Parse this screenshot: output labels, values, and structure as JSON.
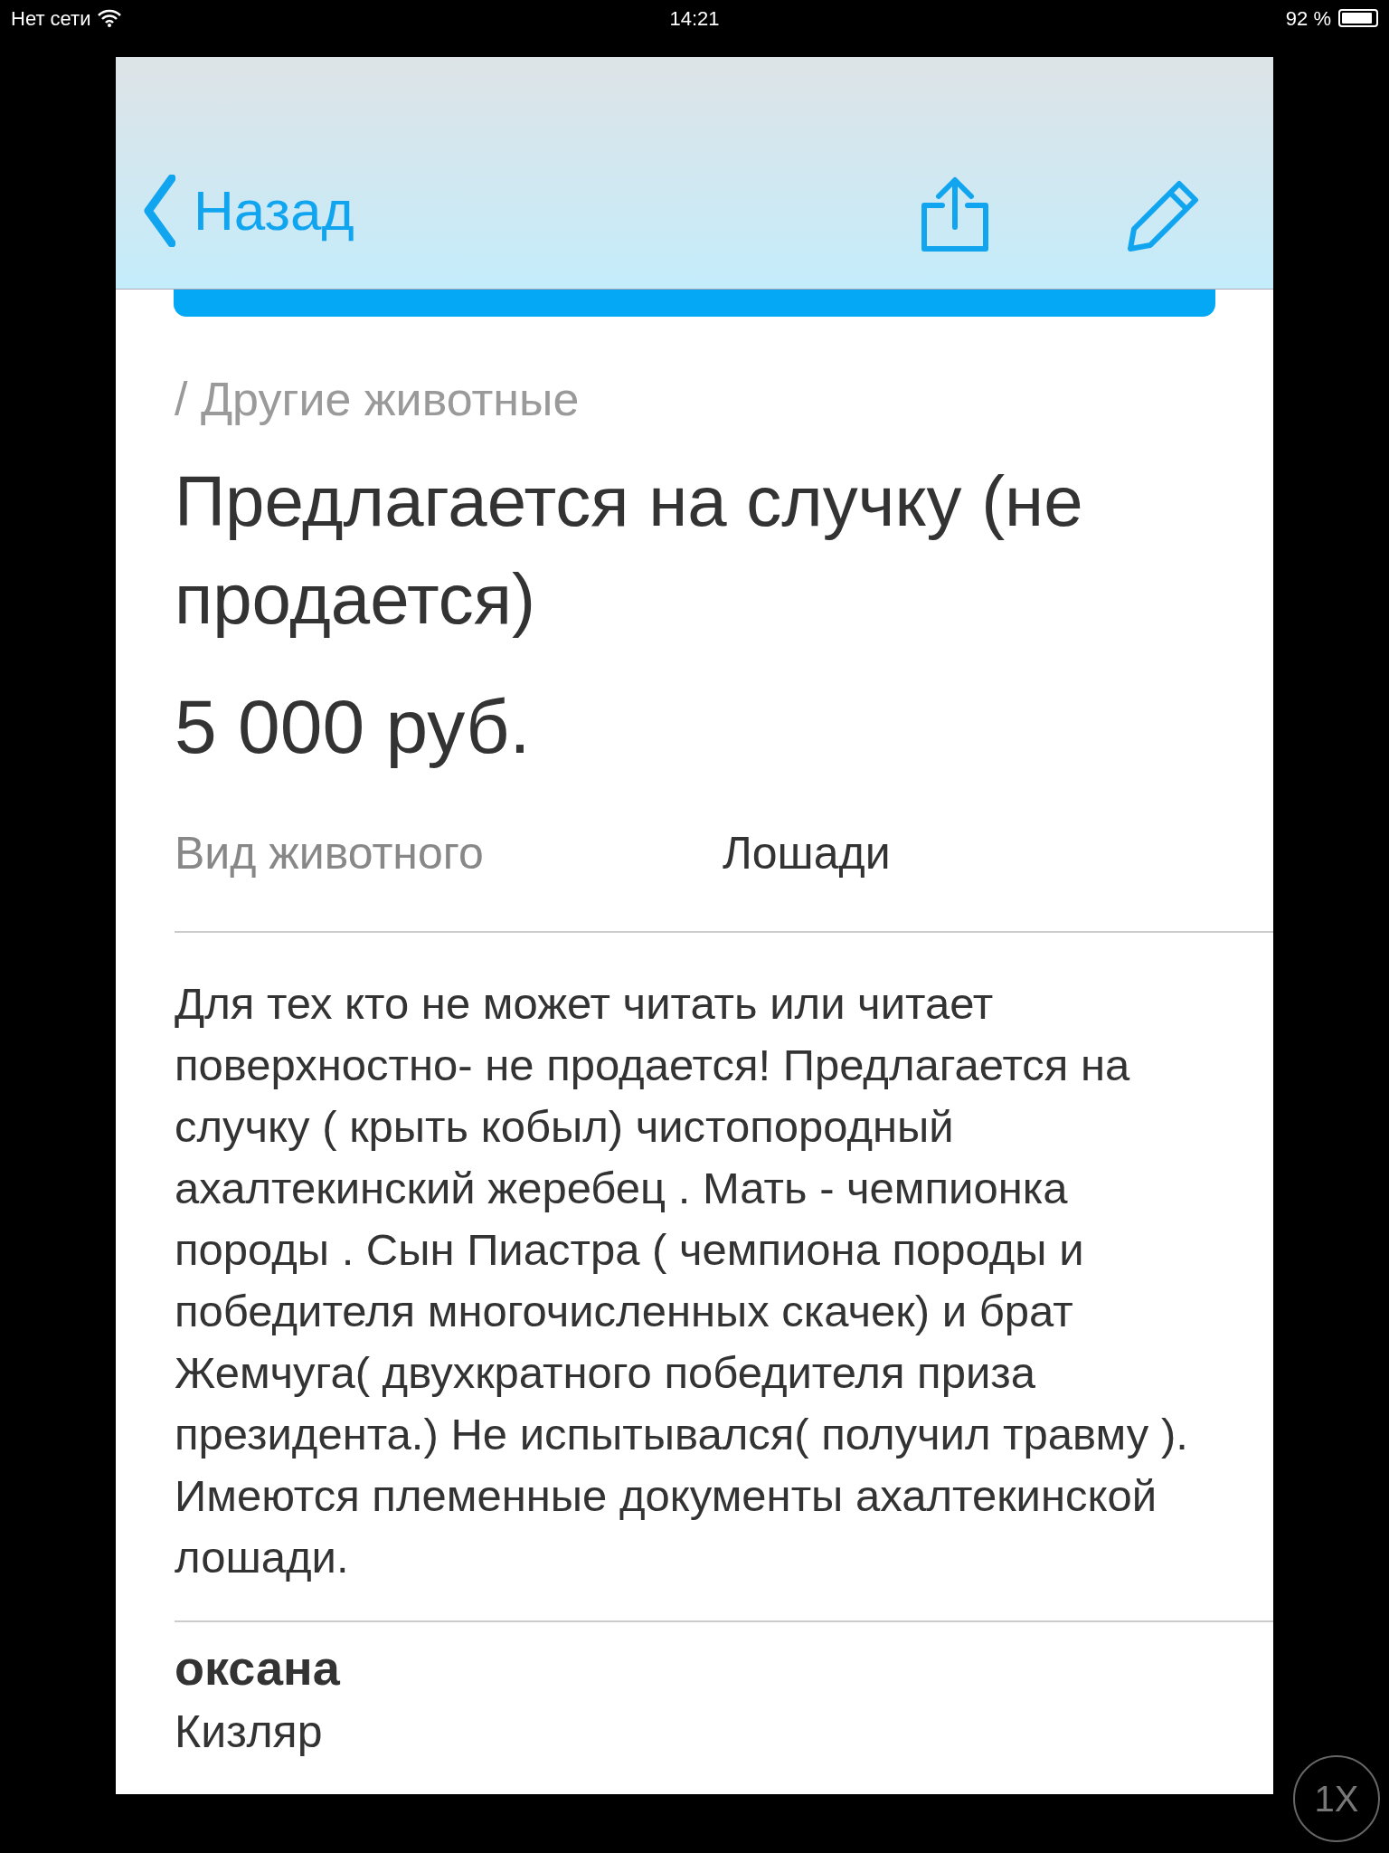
{
  "status_bar": {
    "carrier": "Нет сети",
    "time": "14:21",
    "battery": "92 %"
  },
  "nav_bar": {
    "back": "Назад"
  },
  "breadcrumb": "/ Другие животные",
  "title": "Предлагается на случку (не продается)",
  "price": "5 000 руб.",
  "attributes": [
    {
      "label": "Вид животного",
      "value": "Лошади"
    }
  ],
  "description": "Для тех кто не может читать или читает поверхностно- не продается! Предлагается на случку ( крыть кобыл) чистопородный ахалтекинский жеребец . Мать - чемпионка породы . Сын Пиастра ( чемпиона породы и победителя многочисленных скачек) и брат Жемчуга( двухкратного победителя  приза президента.) Не испытывался( получил травму ). Имеются племенные документы ахалтекинской лошади.",
  "seller": {
    "name": "оксана",
    "city": "Кизляр"
  },
  "zoom_button": "1X"
}
